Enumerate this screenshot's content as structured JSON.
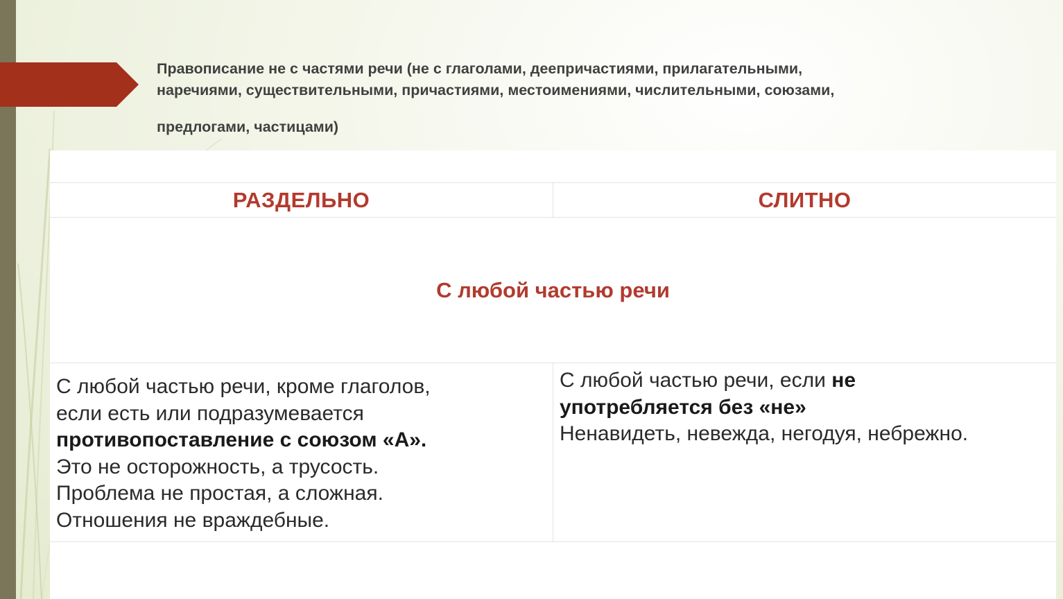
{
  "slide": {
    "title_line1": "Правописание не с частями речи (не с глаголами, деепричастиями, прилагательными,",
    "title_line2": "наречиями, существительными, причастиями, местоимениями, числительными, союзами,",
    "title_line3": "предлогами, частицами)",
    "accent_color": "#a3301b",
    "header_color": "#b23a2e"
  },
  "table": {
    "headers": {
      "left": "РАЗДЕЛЬНО",
      "right": "СЛИТНО"
    },
    "merged_row": "С любой частью речи",
    "left_cell": {
      "line1": "С любой частью речи, кроме глаголов,",
      "line2": "если есть или подразумевается",
      "line3_bold": "противопоставление с союзом «А».",
      "example1": "Это не осторожность, а трусость.",
      "example2": "Проблема не простая, а сложная.",
      "example3": "Отношения не враждебные."
    },
    "right_cell": {
      "line1_text": "С любой частью речи, если ",
      "line1_bold": "не",
      "line2_bold": "употребляется без «не»",
      "example": "Ненавидеть, невежда, негодуя, небрежно."
    }
  }
}
